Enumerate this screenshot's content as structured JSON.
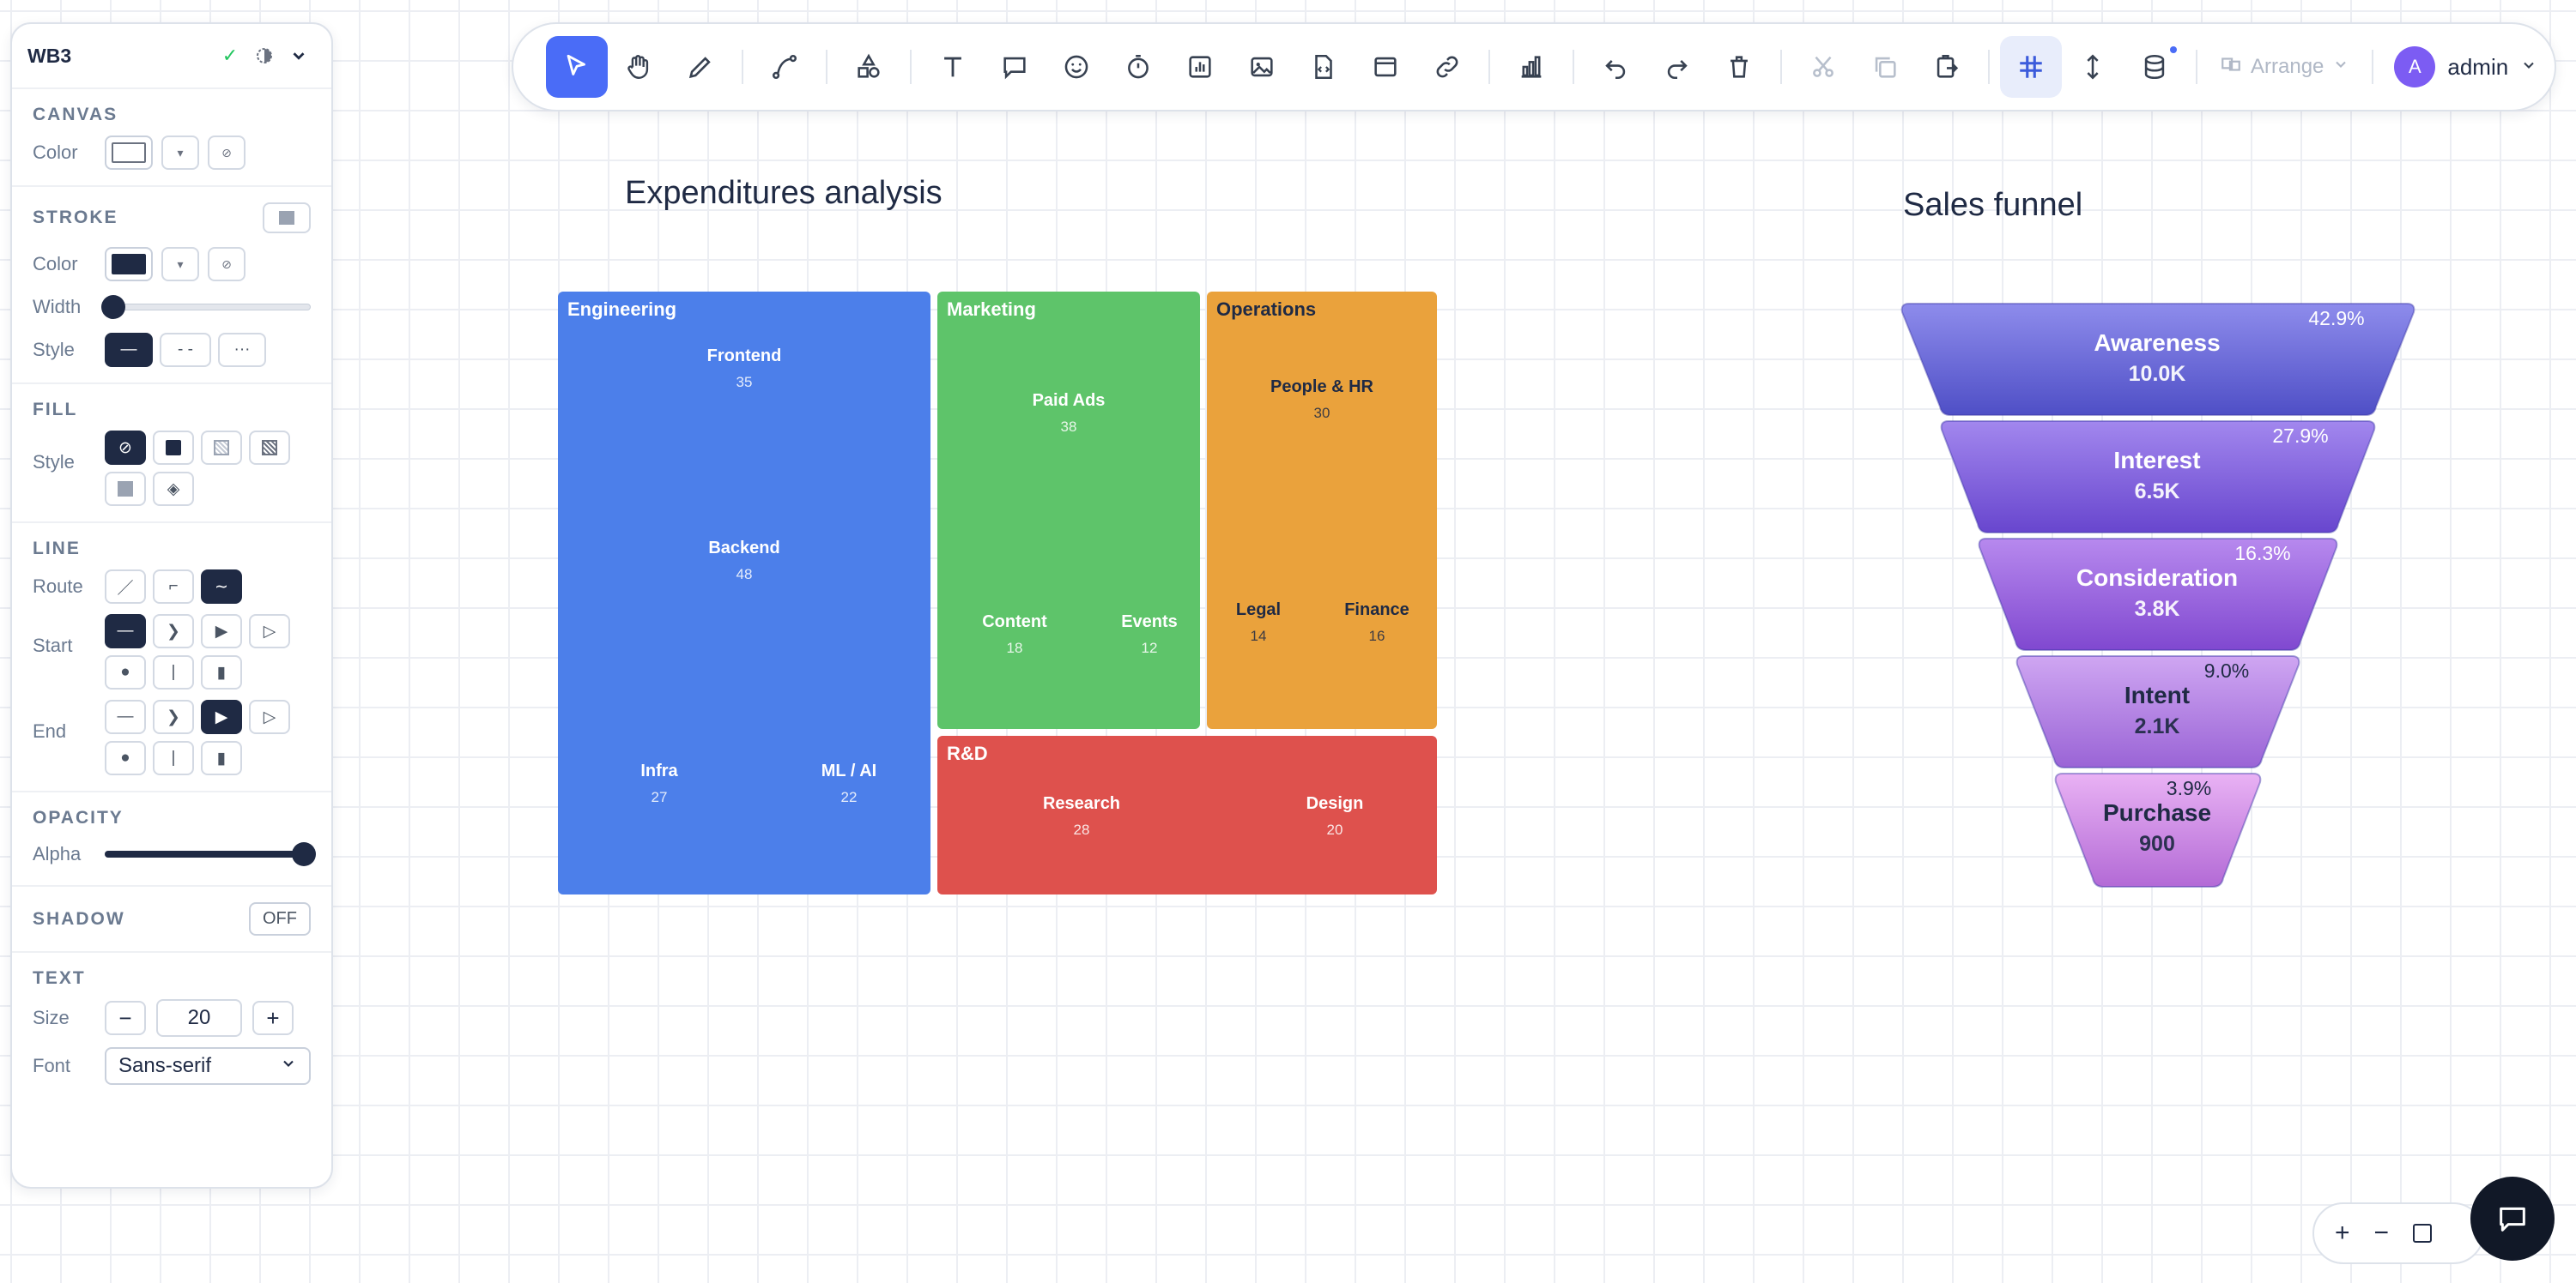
{
  "panel": {
    "board_name": "WB3",
    "canvas": {
      "title": "CANVAS",
      "color_label": "Color"
    },
    "stroke": {
      "title": "STROKE",
      "color_label": "Color",
      "width_label": "Width",
      "style_label": "Style",
      "width_value": 0.04,
      "styles": [
        "—",
        "- -",
        "···"
      ]
    },
    "fill": {
      "title": "FILL",
      "style_label": "Style"
    },
    "line": {
      "title": "LINE",
      "route_label": "Route",
      "start_label": "Start",
      "end_label": "End"
    },
    "opacity": {
      "title": "OPACITY",
      "alpha_label": "Alpha",
      "alpha_value": 1.0
    },
    "shadow": {
      "title": "SHADOW",
      "state": "OFF"
    },
    "text": {
      "title": "TEXT",
      "size_label": "Size",
      "size_value": "20",
      "font_label": "Font",
      "font_value": "Sans-serif"
    }
  },
  "toolbar": {
    "arrange_label": "Arrange",
    "user_initial": "A",
    "user_name": "admin"
  },
  "treemap": {
    "title": "Expenditures analysis",
    "groups": [
      {
        "name": "Engineering",
        "color": "#4c7fea",
        "text_color": "#ffffff",
        "items": [
          {
            "name": "Frontend",
            "value": "35"
          },
          {
            "name": "Backend",
            "value": "48"
          },
          {
            "name": "Infra",
            "value": "27"
          },
          {
            "name": "ML / AI",
            "value": "22"
          }
        ]
      },
      {
        "name": "Marketing",
        "color": "#5ec46a",
        "text_color": "#ffffff",
        "items": [
          {
            "name": "Paid Ads",
            "value": "38"
          },
          {
            "name": "Content",
            "value": "18"
          },
          {
            "name": "Events",
            "value": "12"
          }
        ]
      },
      {
        "name": "Operations",
        "color": "#eaa23c",
        "text_color": "#1f2a44",
        "items": [
          {
            "name": "People & HR",
            "value": "30"
          },
          {
            "name": "Legal",
            "value": "14"
          },
          {
            "name": "Finance",
            "value": "16"
          }
        ]
      },
      {
        "name": "R&D",
        "color": "#de514d",
        "text_color": "#ffffff",
        "items": [
          {
            "name": "Research",
            "value": "28"
          },
          {
            "name": "Design",
            "value": "20"
          }
        ]
      }
    ]
  },
  "funnel": {
    "title": "Sales funnel",
    "stages": [
      {
        "name": "Awareness",
        "value": "10.0K",
        "pct": "42.9%",
        "color_top": "#8e8cec",
        "color_bottom": "#4f4fc6",
        "text_color": "#ffffff"
      },
      {
        "name": "Interest",
        "value": "6.5K",
        "pct": "27.9%",
        "color_top": "#a287ee",
        "color_bottom": "#6846ce",
        "text_color": "#ffffff"
      },
      {
        "name": "Consideration",
        "value": "3.8K",
        "pct": "16.3%",
        "color_top": "#b789ee",
        "color_bottom": "#8048d0",
        "text_color": "#ffffff"
      },
      {
        "name": "Intent",
        "value": "2.1K",
        "pct": "9.0%",
        "color_top": "#cfa6f2",
        "color_bottom": "#9a64d6",
        "text_color": "#1f2a44"
      },
      {
        "name": "Purchase",
        "value": "900",
        "pct": "3.9%",
        "color_top": "#e9b2f4",
        "color_bottom": "#b36ad6",
        "text_color": "#1f2a44"
      }
    ]
  }
}
